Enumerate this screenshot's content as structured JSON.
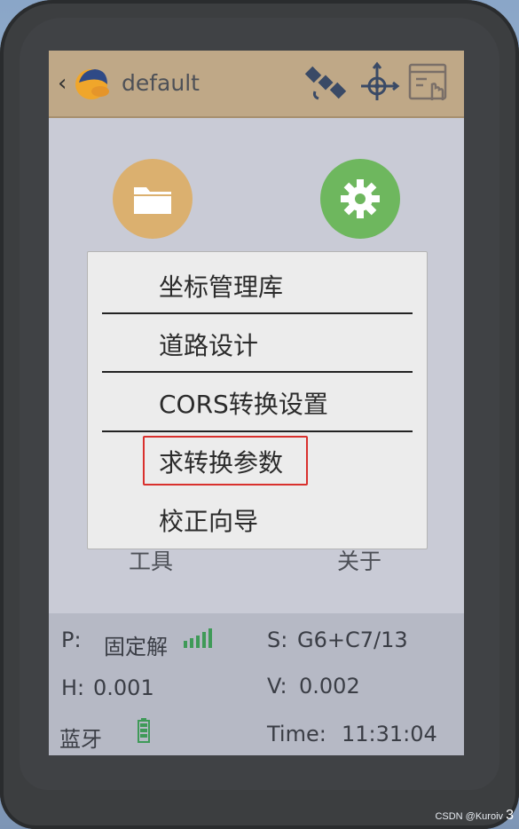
{
  "appbar": {
    "title": "default",
    "icons": [
      "back-chevron-icon",
      "user-avatar-icon",
      "satellite-icon",
      "crosshair-icon",
      "device-window-icon"
    ]
  },
  "main": {
    "folder_icon": "folder-icon",
    "settings_icon": "gear-icon",
    "tools_label": "工具",
    "about_label": "关于"
  },
  "menu": {
    "items": [
      {
        "label": "坐标管理库"
      },
      {
        "label": "道路设计"
      },
      {
        "label": "CORS转换设置"
      },
      {
        "label": "求转换参数"
      },
      {
        "label": "校正向导"
      }
    ],
    "highlighted_index": 3,
    "highlight_color": "#d9302d"
  },
  "status": {
    "p_label": "P:",
    "p_value": "固定解",
    "s_label": "S:",
    "s_value": "G6+C7/13",
    "h_label": "H:",
    "h_value": "0.001",
    "v_label": "V:",
    "v_value": "0.002",
    "connection": "蓝牙",
    "time_label": "Time:",
    "time_value": "11:31:04"
  },
  "colors": {
    "appbar": "#bfa887",
    "folder": "#dbb06f",
    "settings": "#6eb75e",
    "signal": "#3f9a58"
  },
  "watermark": "CSDN @Kuroiv",
  "corner_digit": "3"
}
